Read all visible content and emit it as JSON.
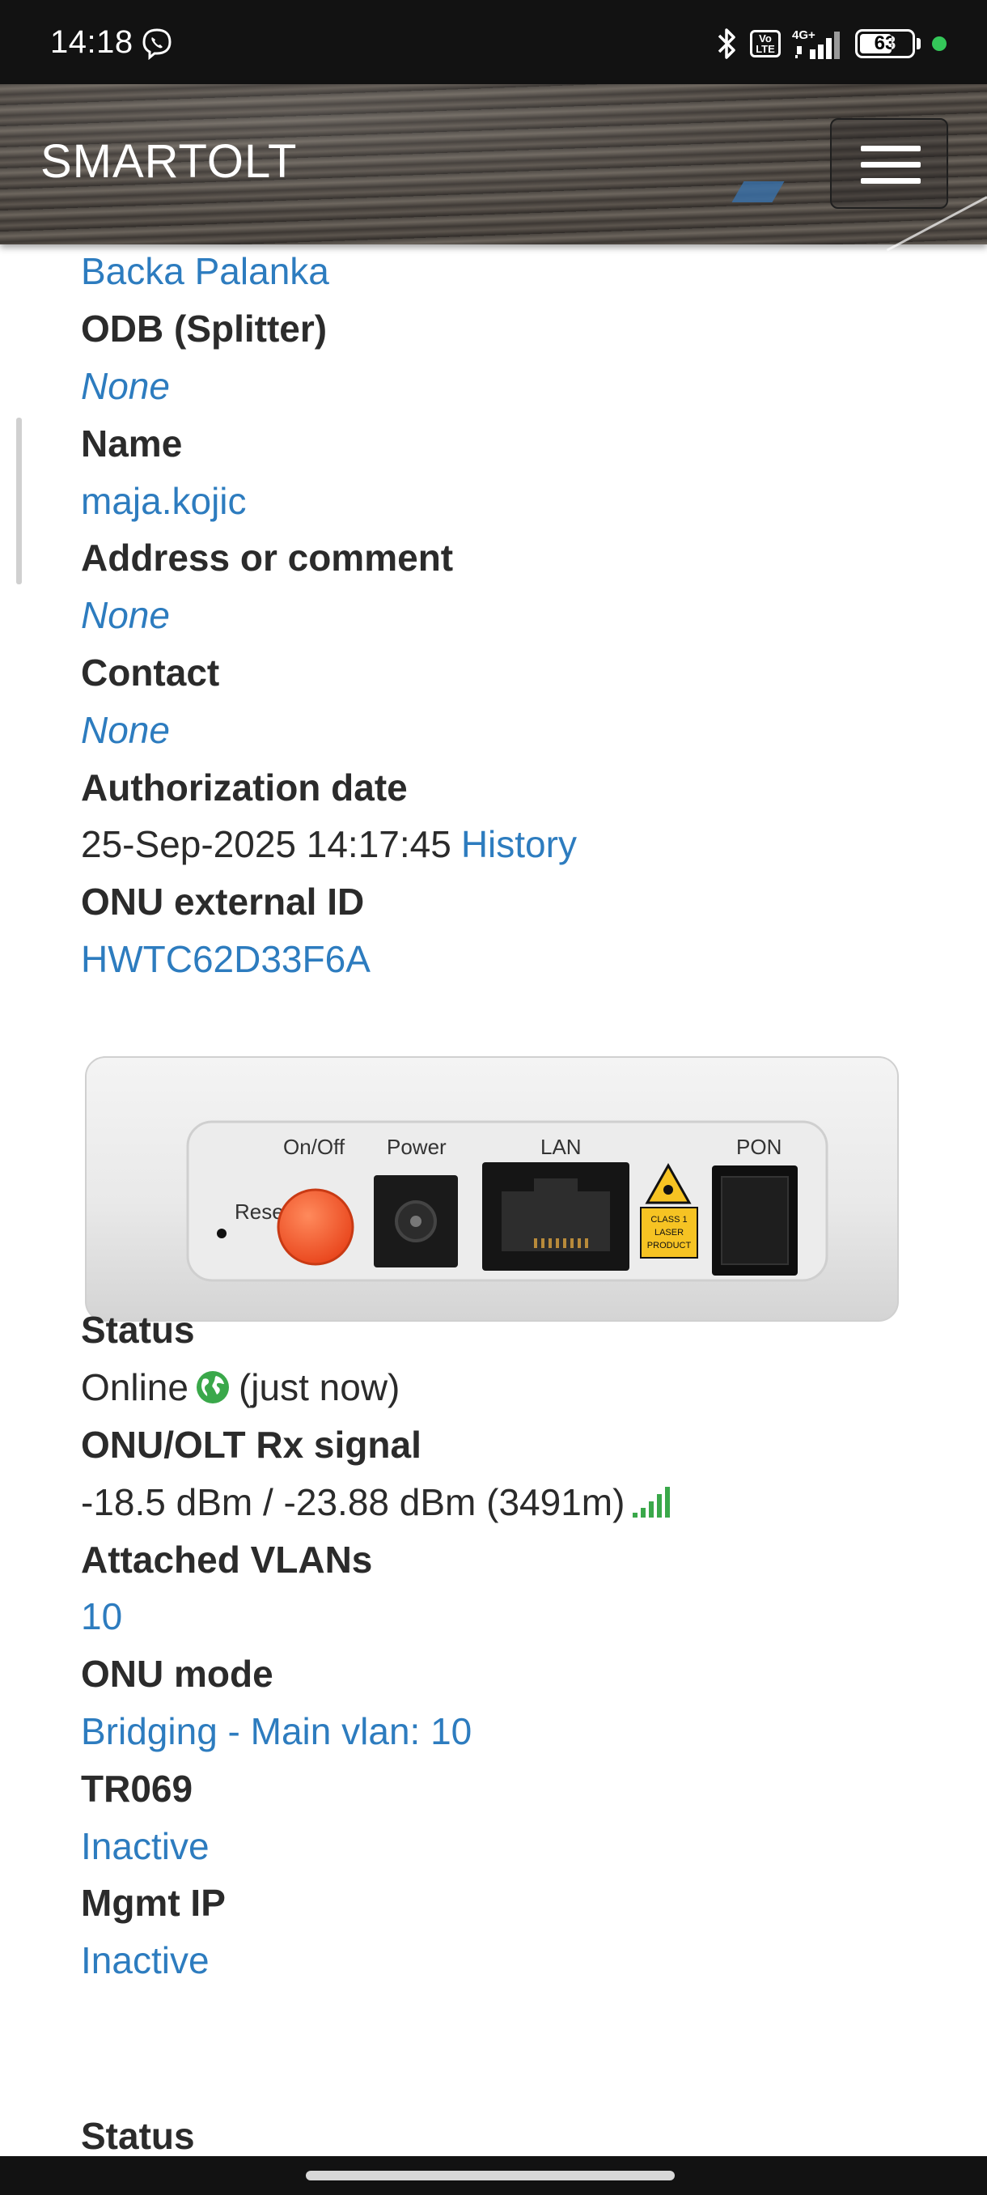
{
  "status_bar": {
    "time": "14:18",
    "volte": "Vo LTE",
    "network": "4G+",
    "battery": "63",
    "battery_level": 0.63,
    "icons": [
      "viber-icon",
      "bluetooth-icon",
      "volte-icon",
      "signal-icon",
      "battery-icon",
      "active-dot-icon"
    ]
  },
  "header": {
    "brand": "SMARTOLT",
    "menu_icon": "hamburger-menu-icon"
  },
  "details": [
    {
      "id": "zone-value",
      "text": "Backa Palanka",
      "style": "link"
    },
    {
      "id": "odb-label",
      "text": "ODB (Splitter)",
      "style": "label"
    },
    {
      "id": "odb-value",
      "text": "None",
      "style": "link italic"
    },
    {
      "id": "name-label",
      "text": "Name",
      "style": "label"
    },
    {
      "id": "name-value",
      "text": "maja.kojic",
      "style": "link"
    },
    {
      "id": "address-label",
      "text": "Address or comment",
      "style": "label"
    },
    {
      "id": "address-value",
      "text": "None",
      "style": "link italic"
    },
    {
      "id": "contact-label",
      "text": "Contact",
      "style": "label"
    },
    {
      "id": "contact-value",
      "text": "None",
      "style": "link italic"
    },
    {
      "id": "authorization-label",
      "text": "Authorization date",
      "style": "label"
    }
  ],
  "authorization": {
    "date": "25-Sep-2025 14:17:45",
    "history_link": "History"
  },
  "external_id": {
    "label": "ONU external ID",
    "value": "HWTC62D33F6A"
  },
  "device_image": {
    "labels": {
      "reset": "Reset",
      "onoff": "On/Off",
      "power": "Power",
      "lan": "LAN",
      "pon": "PON",
      "laser": [
        "CLASS 1",
        "LASER",
        "PRODUCT"
      ]
    }
  },
  "status_section": {
    "status_label": "Status",
    "status_value": "Online",
    "status_time": "(just now)",
    "status_icon": "globe-icon",
    "signal_label": "ONU/OLT Rx signal",
    "signal_value": "-18.5 dBm / -23.88 dBm (3491m)",
    "signal_icon": "signal-strength-icon",
    "vlans_label": "Attached VLANs",
    "vlans_value": "10",
    "mode_label": "ONU mode",
    "mode_value": "Bridging - Main vlan: 10",
    "tr069_label": "TR069",
    "tr069_value": "Inactive",
    "mgmt_label": "Mgmt IP",
    "mgmt_value": "Inactive"
  },
  "next_section_title": "Status",
  "colors": {
    "link": "#2d7cbf",
    "text": "#2b2b2b",
    "online_green": "#3aa84a",
    "statusbar": "#121212"
  }
}
